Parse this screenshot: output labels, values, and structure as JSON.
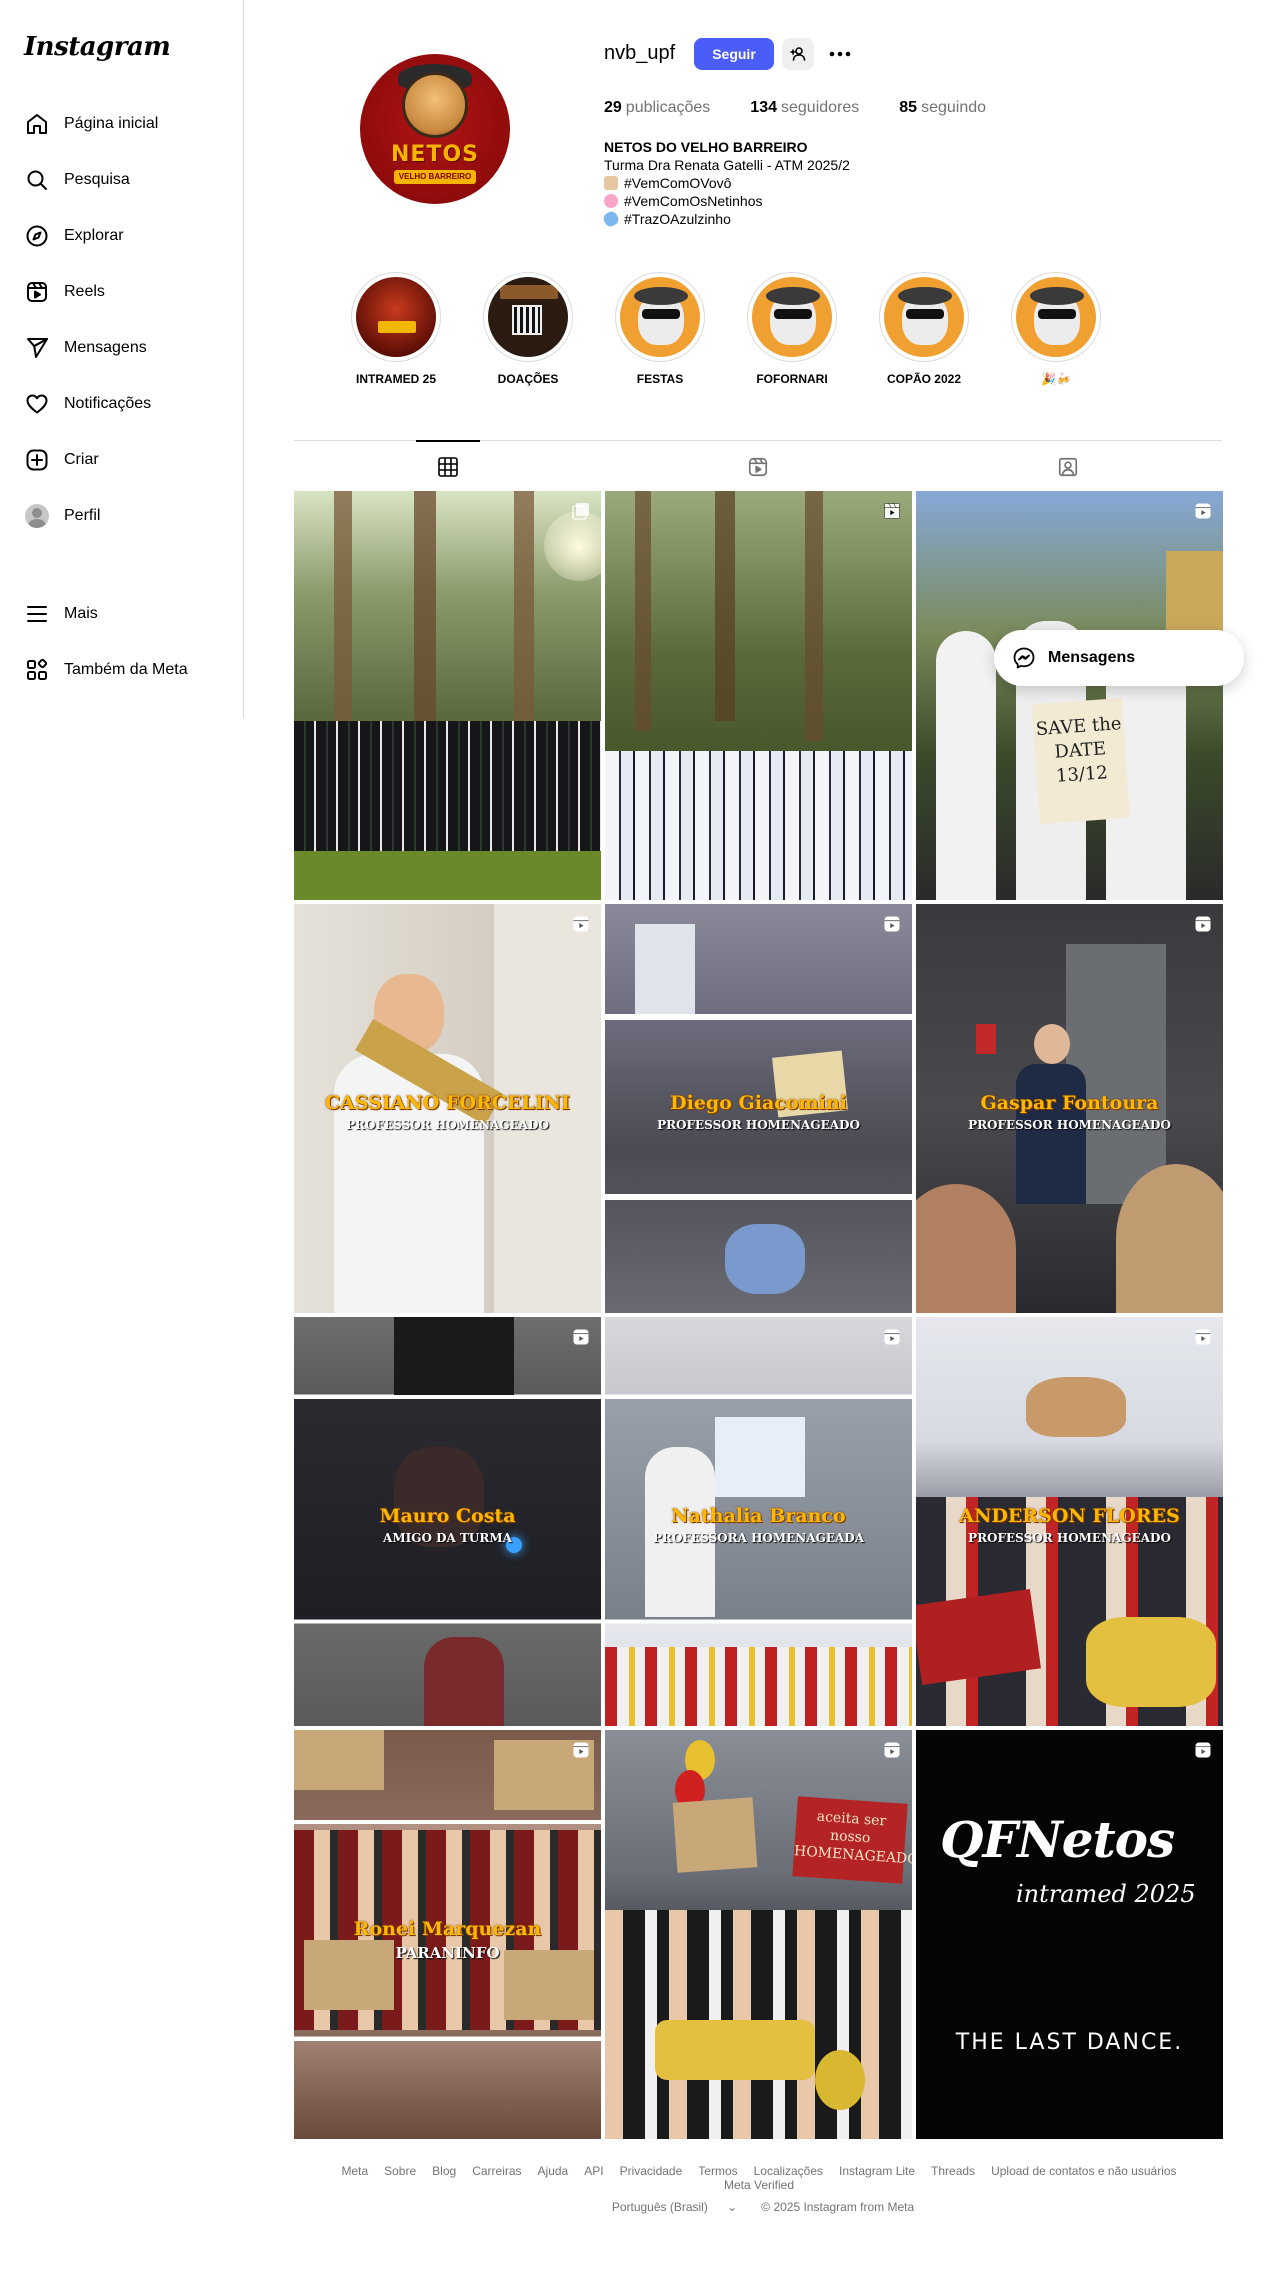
{
  "app": {
    "logo_text": "Instagram"
  },
  "sidebar": {
    "items": [
      {
        "label": "Página inicial",
        "icon": "home-icon"
      },
      {
        "label": "Pesquisa",
        "icon": "search-icon"
      },
      {
        "label": "Explorar",
        "icon": "compass-icon"
      },
      {
        "label": "Reels",
        "icon": "reels-icon"
      },
      {
        "label": "Mensagens",
        "icon": "send-icon"
      },
      {
        "label": "Notificações",
        "icon": "heart-icon"
      },
      {
        "label": "Criar",
        "icon": "plus-square-icon"
      },
      {
        "label": "Perfil",
        "icon": "avatar"
      }
    ],
    "bottom": [
      {
        "label": "Mais",
        "icon": "menu-icon"
      },
      {
        "label": "Também da Meta",
        "icon": "meta-apps-icon"
      }
    ]
  },
  "profile": {
    "username": "nvb_upf",
    "follow_label": "Seguir",
    "stats": {
      "posts_count": "29",
      "posts_label": "publicações",
      "followers_count": "134",
      "followers_label": "seguidores",
      "following_count": "85",
      "following_label": "seguindo"
    },
    "avatar_text": "NETOS",
    "avatar_subtext": "VELHO BARREIRO",
    "bio": {
      "name": "NETOS DO VELHO BARREIRO",
      "line1": "Turma Dra Renata Gatelli - ATM 2025/2",
      "line2": "#VemComOVovô",
      "line3": "#VemComOsNetinhos",
      "line4": "#TrazOAzulzinho"
    }
  },
  "highlights": [
    {
      "label": "INTRAMED 25"
    },
    {
      "label": "DOAÇÕES"
    },
    {
      "label": "FESTAS"
    },
    {
      "label": "FOFORNARI"
    },
    {
      "label": "COPÃO 2022"
    },
    {
      "label": "🎉🍻"
    }
  ],
  "tabs": {
    "posts": "grid-icon",
    "reels": "reels-icon",
    "tagged": "tagged-icon",
    "active": "posts"
  },
  "posts": [
    {
      "kind": "photo",
      "title": "",
      "subtitle": ""
    },
    {
      "kind": "reel",
      "title": "",
      "subtitle": ""
    },
    {
      "kind": "reel",
      "title": "",
      "subtitle": "",
      "sign": "SAVE the DATE 13/12"
    },
    {
      "kind": "reel",
      "title": "CASSIANO FORCELINI",
      "subtitle": "PROFESSOR HOMENAGEADO"
    },
    {
      "kind": "reel",
      "title": "Diego Giacomini",
      "subtitle": "PROFESSOR HOMENAGEADO"
    },
    {
      "kind": "reel",
      "title": "Gaspar Fontoura",
      "subtitle": "PROFESSOR HOMENAGEADO"
    },
    {
      "kind": "reel",
      "title": "Mauro Costa",
      "subtitle": "AMIGO DA TURMA"
    },
    {
      "kind": "reel",
      "title": "Nathalia Branco",
      "subtitle": "PROFESSORA HOMENAGEADA"
    },
    {
      "kind": "reel",
      "title": "ANDERSON FLORES",
      "subtitle": "PROFESSOR HOMENAGEADO"
    },
    {
      "kind": "reel",
      "title": "Ronei Marquezan",
      "subtitle": "PARANINFO"
    },
    {
      "kind": "reel",
      "title": "",
      "subtitle": "",
      "sign": "aceita ser nosso HOMENAGEADO"
    },
    {
      "kind": "reel",
      "title": "QFNetos",
      "subtitle": "intramed 2025",
      "tagline": "THE LAST DANCE."
    }
  ],
  "messages_pill": {
    "label": "Mensagens"
  },
  "footer": {
    "links": [
      "Meta",
      "Sobre",
      "Blog",
      "Carreiras",
      "Ajuda",
      "API",
      "Privacidade",
      "Termos",
      "Localizações",
      "Instagram Lite",
      "Threads",
      "Upload de contatos e não usuários",
      "Meta Verified"
    ],
    "language": "Português (Brasil)",
    "copyright": "© 2025 Instagram from Meta"
  },
  "colors": {
    "follow_button": "#4a5df9",
    "text_secondary": "#737373",
    "border": "#dbdbdb"
  }
}
